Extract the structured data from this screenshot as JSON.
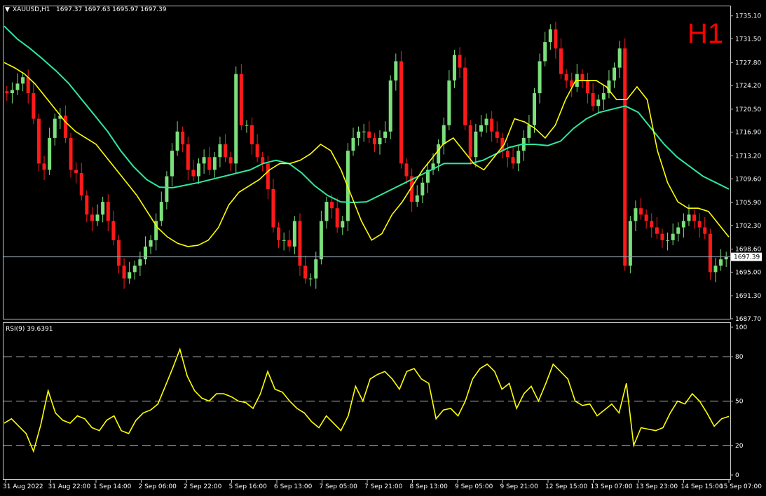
{
  "colors": {
    "background": "#000000",
    "frame": "#c8c8c8",
    "bull": "#7be07b",
    "bear": "#ff1a1a",
    "ma_fast": "#ffff00",
    "ma_slow": "#2ee8a0",
    "rsi": "#ffff00",
    "price_line": "#9aa5b1",
    "price_tag_bg": "#ffffff",
    "price_tag_text": "#000000",
    "timeframe_label": "#ff0000"
  },
  "header": {
    "symbol": "XAUUSD,H1",
    "ohlc": "1697.37 1697.63 1695.97 1697.39",
    "timeframe_label": "H1"
  },
  "current_price_label": "1697.39",
  "rsi_header": "RSI(9) 39.6391",
  "chart_data": [
    {
      "type": "candlestick",
      "symbol": "XAUUSD",
      "timeframe": "H1",
      "ylim": [
        1687.7,
        1736.6
      ],
      "y_ticks": [
        "1735.10",
        "1731.50",
        "1727.80",
        "1724.20",
        "1720.50",
        "1716.90",
        "1713.20",
        "1709.60",
        "1705.90",
        "1702.30",
        "1698.60",
        "1695.00",
        "1691.30",
        "1687.70"
      ],
      "current_price": 1697.39,
      "x_tick_labels": [
        "31 Aug 2022",
        "31 Aug 22:00",
        "1 Sep 14:00",
        "2 Sep 06:00",
        "2 Sep 22:00",
        "5 Sep 16:00",
        "6 Sep 13:00",
        "7 Sep 05:00",
        "7 Sep 21:00",
        "8 Sep 13:00",
        "9 Sep 05:00",
        "9 Sep 21:00",
        "12 Sep 15:00",
        "13 Sep 07:00",
        "13 Sep 23:00",
        "14 Sep 15:00",
        "15 Sep 07:00"
      ],
      "close_path": [
        1723,
        1723.5,
        1724.5,
        1725.5,
        1723,
        1719,
        1712,
        1711,
        1716,
        1719,
        1719.5,
        1716,
        1711,
        1710.5,
        1707,
        1704,
        1703,
        1704,
        1706,
        1703,
        1700,
        1696,
        1694,
        1695,
        1696,
        1697,
        1699,
        1700,
        1703,
        1706,
        1710,
        1714,
        1717,
        1715,
        1711,
        1710,
        1712,
        1713,
        1711,
        1713,
        1715,
        1713,
        1712,
        1726,
        1718,
        1718,
        1715,
        1713,
        1712,
        1708,
        1702,
        1700,
        1700,
        1699,
        1703,
        1696,
        1694,
        1694,
        1697,
        1703,
        1706,
        1705,
        1702,
        1703,
        1714,
        1716,
        1717,
        1717,
        1716,
        1715,
        1716,
        1717,
        1725,
        1728,
        1712,
        1710,
        1706,
        1707,
        1709,
        1711,
        1712,
        1715,
        1718,
        1725,
        1729,
        1727,
        1718,
        1713,
        1717,
        1718,
        1719,
        1717,
        1716,
        1714,
        1713,
        1712,
        1714,
        1716,
        1718,
        1723,
        1728,
        1731,
        1733,
        1730,
        1726,
        1725,
        1724,
        1726,
        1725,
        1723,
        1721,
        1722,
        1723,
        1725,
        1727,
        1730,
        1696,
        1703,
        1705,
        1704,
        1703,
        1702,
        1701,
        1700,
        1700,
        1701,
        1702,
        1703,
        1704,
        1703,
        1702,
        1701,
        1695,
        1696,
        1697,
        1697.39
      ],
      "ma_fast": [
        1727.8,
        1727,
        1726,
        1724.5,
        1722.5,
        1720.5,
        1718.5,
        1717,
        1716,
        1715,
        1713,
        1711,
        1709,
        1707,
        1704.5,
        1702,
        1700.5,
        1699.5,
        1699,
        1699.2,
        1700,
        1702,
        1705.5,
        1707.5,
        1708.5,
        1709.5,
        1711,
        1712,
        1712,
        1712.5,
        1713.5,
        1715,
        1714,
        1711,
        1707,
        1703,
        1700,
        1701,
        1704,
        1706,
        1708.5,
        1711,
        1713,
        1715,
        1716,
        1714,
        1712,
        1711,
        1713,
        1715,
        1719,
        1718.5,
        1717.5,
        1716,
        1718,
        1722,
        1725,
        1725,
        1725,
        1724,
        1722,
        1722,
        1724,
        1722,
        1714,
        1709,
        1706,
        1705,
        1705,
        1704.5,
        1702.5,
        1700.5
      ],
      "ma_slow": [
        1733.5,
        1731.5,
        1730,
        1728.3,
        1726.5,
        1724.5,
        1722,
        1719.5,
        1717,
        1714,
        1711.5,
        1709.5,
        1708.3,
        1708.2,
        1708.6,
        1709,
        1709.5,
        1710,
        1710.5,
        1711,
        1712,
        1712.5,
        1712,
        1710.5,
        1708.5,
        1707,
        1706,
        1705.9,
        1706,
        1707,
        1708,
        1709,
        1710,
        1711,
        1712,
        1712,
        1712,
        1712.5,
        1713.5,
        1714.5,
        1715,
        1715,
        1714.8,
        1715.5,
        1717.5,
        1719,
        1720,
        1720.5,
        1721,
        1720,
        1717.5,
        1715,
        1713,
        1711.5,
        1710,
        1709,
        1708
      ]
    },
    {
      "type": "line",
      "indicator": "RSI(9)",
      "value": 39.6391,
      "ylim": [
        0,
        100
      ],
      "y_ticks": [
        "100",
        "80",
        "50",
        "20",
        "0"
      ],
      "levels": [
        80,
        50,
        20
      ],
      "values": [
        35,
        38,
        33,
        28,
        16,
        34,
        57,
        42,
        37,
        35,
        40,
        38,
        32,
        30,
        37,
        40,
        30,
        28,
        37,
        42,
        44,
        48,
        60,
        72,
        85,
        67,
        57,
        52,
        50,
        55,
        55,
        53,
        50,
        49,
        45,
        55,
        70,
        58,
        56,
        50,
        45,
        42,
        36,
        32,
        40,
        35,
        30,
        40,
        60,
        50,
        65,
        68,
        70,
        65,
        58,
        70,
        72,
        65,
        62,
        38,
        44,
        45,
        40,
        50,
        65,
        72,
        75,
        70,
        58,
        62,
        45,
        55,
        60,
        50,
        62,
        75,
        70,
        65,
        50,
        47,
        48,
        40,
        44,
        48,
        42,
        62,
        20,
        32,
        31,
        30,
        32,
        42,
        50,
        48,
        55,
        50,
        42,
        33,
        38,
        39.6
      ]
    }
  ]
}
